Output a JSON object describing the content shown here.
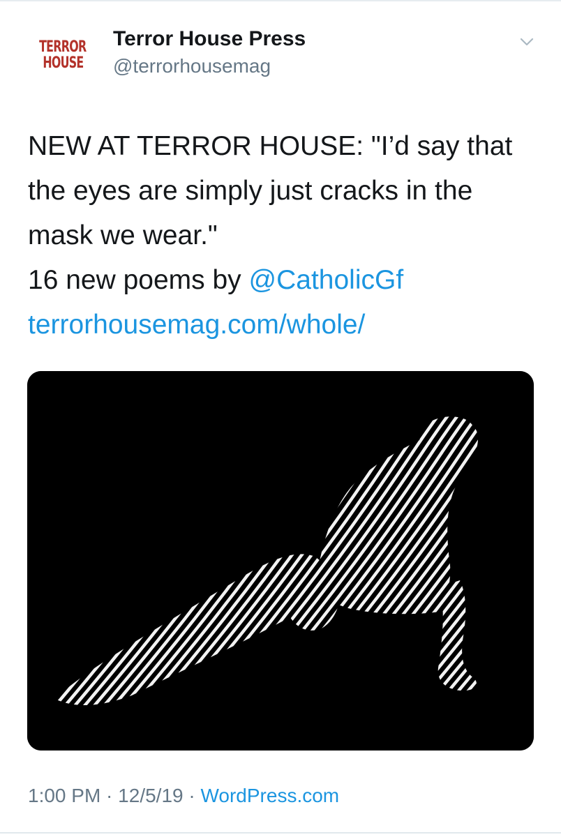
{
  "author": {
    "avatar_logo_lines": [
      "TERROR",
      "HOUSE"
    ],
    "display_name": "Terror House Press",
    "handle": "@terrorhousemag"
  },
  "menu_icon": "chevron-down-icon",
  "tweet": {
    "line1": "NEW AT TERROR HOUSE: \"I’d say that",
    "line2": "the eyes are simply just cracks in the",
    "line3": "mask we wear.\"",
    "line4_prefix": "16 new poems by ",
    "mention": "@CatholicGf",
    "url": "terrorhousemag.com/whole/"
  },
  "meta": {
    "time": "1:00 PM",
    "separator1": " · ",
    "date": "12/5/19",
    "separator2": " · ",
    "source": "WordPress.com"
  },
  "colors": {
    "link": "#1b95e0",
    "secondary_text": "#657786",
    "logo_red": "#b3322a"
  }
}
